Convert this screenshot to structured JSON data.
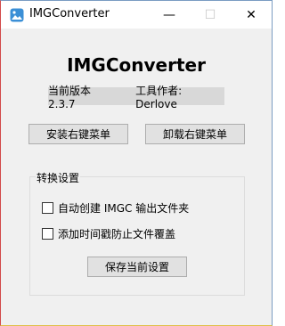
{
  "window": {
    "title": "IMGConverter",
    "minimize_glyph": "—",
    "maximize_glyph": "☐",
    "close_glyph": "✕",
    "icon": "image-icon"
  },
  "main": {
    "heading": "IMGConverter",
    "version_label": "当前版本 2.3.7",
    "author_label": "工具作者: Derlove",
    "install_button": "安装右键菜单",
    "uninstall_button": "卸载右键菜单"
  },
  "settings": {
    "group_title": "转换设置",
    "option1": "自动创建 IMGC 输出文件夹",
    "option2": "添加时间戳防止文件覆盖",
    "option1_checked": false,
    "option2_checked": false,
    "save_button": "保存当前设置"
  },
  "colors": {
    "icon_blue": "#3b8fd6",
    "background": "#f0f0f0"
  }
}
